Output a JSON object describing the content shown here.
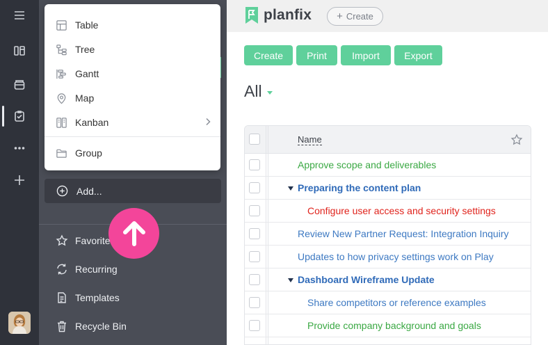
{
  "app": {
    "name": "planfix",
    "create_label": "Create"
  },
  "popup": {
    "items": [
      {
        "label": "Table",
        "icon": "table-icon"
      },
      {
        "label": "Tree",
        "icon": "tree-icon"
      },
      {
        "label": "Gantt",
        "icon": "gantt-icon"
      },
      {
        "label": "Map",
        "icon": "map-pin-icon"
      },
      {
        "label": "Kanban",
        "icon": "kanban-icon",
        "has_submenu": true
      },
      {
        "label": "Group",
        "icon": "folder-icon"
      }
    ]
  },
  "sidebar": {
    "add_label": "Add...",
    "items": [
      {
        "label": "Favorites",
        "icon": "star-icon"
      },
      {
        "label": "Recurring",
        "icon": "recurring-icon"
      },
      {
        "label": "Templates",
        "icon": "templates-icon"
      },
      {
        "label": "Recycle Bin",
        "icon": "trash-icon"
      }
    ]
  },
  "toolbar": {
    "create": "Create",
    "print": "Print",
    "import": "Import",
    "export": "Export"
  },
  "view": {
    "title": "All"
  },
  "table": {
    "header": {
      "name": "Name"
    },
    "rows": [
      {
        "text": "Approve scope and deliverables",
        "color": "#3aa843",
        "bold": false,
        "expandable": false,
        "indent": 0
      },
      {
        "text": "Preparing the content plan",
        "color": "#2f6ab8",
        "bold": true,
        "expandable": true,
        "indent": 0
      },
      {
        "text": "Configure user access and security settings",
        "color": "#e0231c",
        "bold": false,
        "expandable": false,
        "indent": 1
      },
      {
        "text": "Review New Partner Request: Integration Inquiry",
        "color": "#3d79c2",
        "bold": false,
        "expandable": false,
        "indent": 0
      },
      {
        "text": "Updates to how privacy settings work on Play",
        "color": "#3d79c2",
        "bold": false,
        "expandable": false,
        "indent": 0
      },
      {
        "text": "Dashboard Wireframe Update",
        "color": "#2f6ab8",
        "bold": true,
        "expandable": true,
        "indent": 0
      },
      {
        "text": "Share competitors or reference examples",
        "color": "#3d79c2",
        "bold": false,
        "expandable": false,
        "indent": 1
      },
      {
        "text": "Provide company background and goals",
        "color": "#3aa843",
        "bold": false,
        "expandable": false,
        "indent": 1
      }
    ]
  },
  "colors": {
    "accent": "#5fd09b",
    "rail": "#2f323a",
    "sidebar": "#4a4d56",
    "highlight": "#f3459a"
  }
}
